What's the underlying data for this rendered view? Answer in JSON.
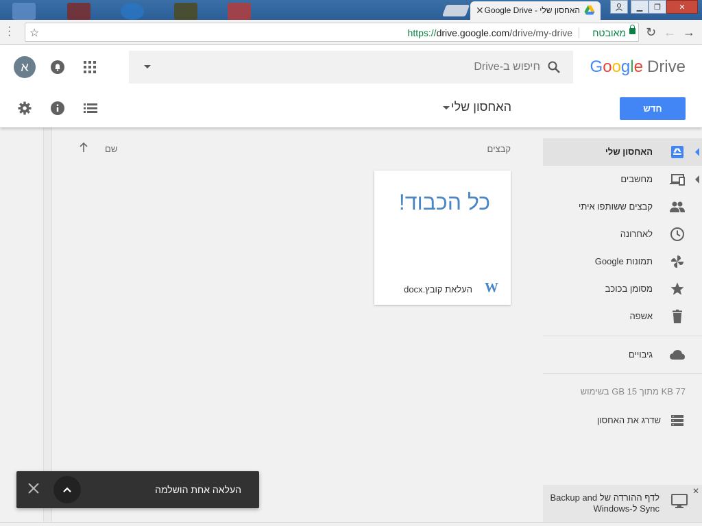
{
  "browser": {
    "tab_title": "האחסון שלי - Google Drive",
    "url_scheme": "https://",
    "url_host": "drive.google.com",
    "url_path": "/drive/my-drive",
    "secure_label": "מאובטח"
  },
  "header": {
    "logo_google": "Google",
    "logo_drive": "Drive",
    "search_placeholder": "חיפוש ב-Drive",
    "avatar_letter": "א",
    "new_button": "חדש",
    "breadcrumb": "האחסון שלי"
  },
  "sidebar": {
    "items": [
      {
        "label": "האחסון שלי",
        "icon": "my-drive-icon"
      },
      {
        "label": "מחשבים",
        "icon": "computers-icon"
      },
      {
        "label": "קבצים ששותפו איתי",
        "icon": "shared-people-icon"
      },
      {
        "label": "לאחרונה",
        "icon": "clock-icon"
      },
      {
        "label": "תמונות Google",
        "icon": "photos-pinwheel-icon"
      },
      {
        "label": "מסומן בכוכב",
        "icon": "star-icon"
      },
      {
        "label": "אשפה",
        "icon": "trash-icon"
      },
      {
        "label": "גיבויים",
        "icon": "cloud-icon"
      }
    ],
    "storage": "77 KB מתוך 15 GB בשימוש",
    "upgrade": "שדרג את האחסון"
  },
  "main": {
    "files_label": "קבצים",
    "name_column": "שם",
    "file": {
      "preview_text": "כל הכבוד!",
      "name": "העלאת קובץ.docx"
    }
  },
  "snackbar": {
    "text": "העלאה אחת הושלמה"
  },
  "promo": {
    "text": "לדף ההורדה של Backup and Sync ל-Windows"
  },
  "colors": {
    "accent": "#4285f4",
    "drive_grey": "#6f6f6f",
    "secure_green": "#0b8043",
    "preview_blue": "#4a86c5"
  }
}
